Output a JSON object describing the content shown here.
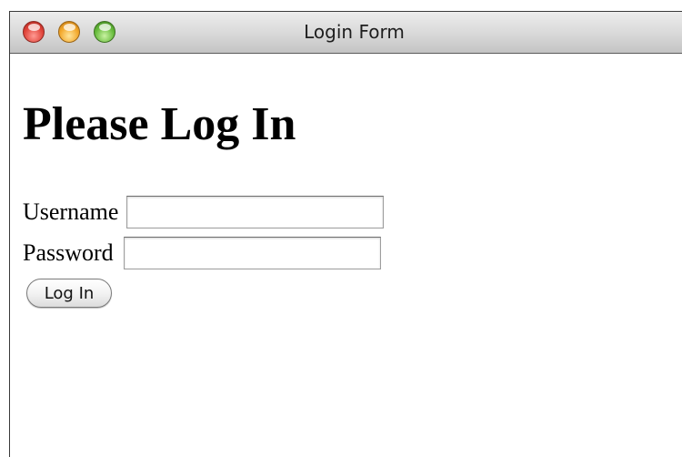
{
  "window": {
    "title": "Login Form",
    "controls": [
      "close",
      "minimize",
      "zoom"
    ]
  },
  "page": {
    "heading": "Please Log In"
  },
  "form": {
    "username_label": "Username",
    "username_value": "",
    "password_label": "Password",
    "password_value": "",
    "submit_label": "Log In"
  },
  "colors": {
    "close": "#e0443a",
    "minimize": "#f3a72a",
    "zoom": "#66bb3b",
    "titlebar": "#dcdcdc",
    "background": "#ffffff"
  }
}
